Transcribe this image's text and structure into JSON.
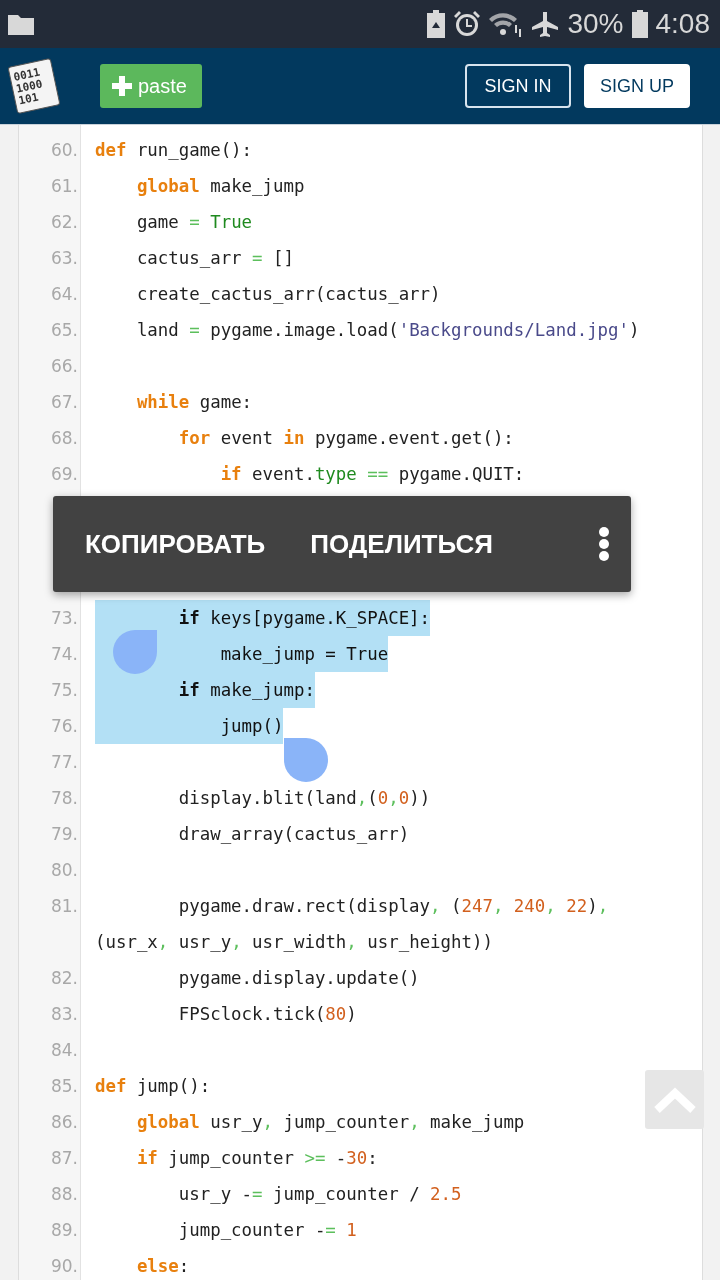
{
  "status_bar": {
    "battery_percent": "30%",
    "time": "4:08"
  },
  "header": {
    "logo_lines": [
      "0011",
      "1000",
      "101"
    ],
    "paste_button": "paste",
    "sign_in": "SIGN IN",
    "sign_up": "SIGN UP"
  },
  "code_lines": [
    {
      "kind": "line",
      "number": "60.",
      "selected": false,
      "tokens": [
        {
          "kind": "kw",
          "text": "def"
        },
        {
          "kind": "plain",
          "text": " run_game():"
        }
      ]
    },
    {
      "kind": "line",
      "number": "61.",
      "selected": false,
      "tokens": [
        {
          "kind": "kw",
          "text": "    global"
        },
        {
          "kind": "plain",
          "text": " make_jump"
        }
      ]
    },
    {
      "kind": "line",
      "number": "62.",
      "selected": false,
      "tokens": [
        {
          "kind": "plain",
          "text": "    game "
        },
        {
          "kind": "op",
          "text": "="
        },
        {
          "kind": "const",
          "text": " True"
        }
      ]
    },
    {
      "kind": "line",
      "number": "63.",
      "selected": false,
      "tokens": [
        {
          "kind": "plain",
          "text": "    cactus_arr "
        },
        {
          "kind": "op",
          "text": "="
        },
        {
          "kind": "plain",
          "text": " []"
        }
      ]
    },
    {
      "kind": "line",
      "number": "64.",
      "selected": false,
      "tokens": [
        {
          "kind": "plain",
          "text": "    create_cactus_arr(cactus_arr)"
        }
      ]
    },
    {
      "kind": "line",
      "number": "65.",
      "selected": false,
      "tokens": [
        {
          "kind": "plain",
          "text": "    land "
        },
        {
          "kind": "op",
          "text": "="
        },
        {
          "kind": "plain",
          "text": " pygame.image.load("
        },
        {
          "kind": "str",
          "text": "'Backgrounds/Land.jpg'"
        },
        {
          "kind": "plain",
          "text": ")"
        }
      ]
    },
    {
      "kind": "line",
      "number": "66.",
      "selected": false
    },
    {
      "kind": "line",
      "number": "67.",
      "selected": false,
      "tokens": [
        {
          "kind": "kw",
          "text": "    while"
        },
        {
          "kind": "plain",
          "text": " game:"
        }
      ]
    },
    {
      "kind": "line",
      "number": "68.",
      "selected": false,
      "tokens": [
        {
          "kind": "kw",
          "text": "        for"
        },
        {
          "kind": "plain",
          "text": " event "
        },
        {
          "kind": "kw",
          "text": "in"
        },
        {
          "kind": "plain",
          "text": " pygame.event.get():"
        }
      ]
    },
    {
      "kind": "line",
      "number": "69.",
      "selected": false,
      "tokens": [
        {
          "kind": "kw",
          "text": "            if"
        },
        {
          "kind": "plain",
          "text": " event."
        },
        {
          "kind": "attr",
          "text": "type"
        },
        {
          "kind": "op",
          "text": " =="
        },
        {
          "kind": "plain",
          "text": " pygame.QUIT:"
        }
      ]
    },
    {
      "kind": "menu",
      "actions": [
        "КОПИРОВАТЬ",
        "ПОДЕЛИТЬСЯ"
      ]
    },
    {
      "kind": "line",
      "number": "73.",
      "selected": true,
      "tokens": [
        {
          "kind": "kw",
          "text": "        if"
        },
        {
          "kind": "plain",
          "text": " keys[pygame.K_SPACE]:"
        }
      ]
    },
    {
      "kind": "line",
      "number": "74.",
      "selected": true,
      "start_handle": true,
      "tokens": [
        {
          "kind": "plain",
          "text": "            make_jump "
        },
        {
          "kind": "op",
          "text": "="
        },
        {
          "kind": "const",
          "text": " True"
        }
      ]
    },
    {
      "kind": "line",
      "number": "75.",
      "selected": true,
      "tokens": [
        {
          "kind": "kw",
          "text": "        if"
        },
        {
          "kind": "plain",
          "text": " make_jump:"
        }
      ]
    },
    {
      "kind": "line",
      "number": "76.",
      "selected": true,
      "tokens": [
        {
          "kind": "plain",
          "text": "            jump()"
        }
      ]
    },
    {
      "kind": "line",
      "number": "77.",
      "selected": false,
      "end_handle": true
    },
    {
      "kind": "line",
      "number": "78.",
      "selected": false,
      "tokens": [
        {
          "kind": "plain",
          "text": "        display.blit(land"
        },
        {
          "kind": "punct",
          "text": ","
        },
        {
          "kind": "plain",
          "text": "("
        },
        {
          "kind": "num",
          "text": "0"
        },
        {
          "kind": "punct",
          "text": ","
        },
        {
          "kind": "num",
          "text": "0"
        },
        {
          "kind": "plain",
          "text": "))"
        }
      ]
    },
    {
      "kind": "line",
      "number": "79.",
      "selected": false,
      "tokens": [
        {
          "kind": "plain",
          "text": "        draw_array(cactus_arr)"
        }
      ]
    },
    {
      "kind": "line",
      "number": "80.",
      "selected": false
    },
    {
      "kind": "line",
      "number": "81.",
      "selected": false,
      "tokens": [
        {
          "kind": "plain",
          "text": "        pygame.draw.rect(display"
        },
        {
          "kind": "punct",
          "text": ","
        },
        {
          "kind": "plain",
          "text": " ("
        },
        {
          "kind": "num",
          "text": "247"
        },
        {
          "kind": "punct",
          "text": ","
        },
        {
          "kind": "num",
          "text": " 240"
        },
        {
          "kind": "punct",
          "text": ","
        },
        {
          "kind": "num",
          "text": " 22"
        },
        {
          "kind": "plain",
          "text": ")"
        },
        {
          "kind": "punct",
          "text": ","
        },
        {
          "kind": "plain",
          "text": " (usr_x"
        },
        {
          "kind": "punct",
          "text": ","
        },
        {
          "kind": "plain",
          "text": " usr_y"
        },
        {
          "kind": "punct",
          "text": ","
        },
        {
          "kind": "plain",
          "text": " usr_width"
        },
        {
          "kind": "punct",
          "text": ","
        },
        {
          "kind": "plain",
          "text": " usr_height))"
        }
      ]
    },
    {
      "kind": "line",
      "number": "82.",
      "selected": false,
      "tokens": [
        {
          "kind": "plain",
          "text": "        pygame.display.update()"
        }
      ]
    },
    {
      "kind": "line",
      "number": "83.",
      "selected": false,
      "tokens": [
        {
          "kind": "plain",
          "text": "        FPSclock.tick("
        },
        {
          "kind": "num",
          "text": "80"
        },
        {
          "kind": "plain",
          "text": ")"
        }
      ]
    },
    {
      "kind": "line",
      "number": "84.",
      "selected": false
    },
    {
      "kind": "line",
      "number": "85.",
      "selected": false,
      "tokens": [
        {
          "kind": "kw",
          "text": "def"
        },
        {
          "kind": "plain",
          "text": " jump():"
        }
      ]
    },
    {
      "kind": "line",
      "number": "86.",
      "selected": false,
      "tokens": [
        {
          "kind": "kw",
          "text": "    global"
        },
        {
          "kind": "plain",
          "text": " usr_y"
        },
        {
          "kind": "punct",
          "text": ","
        },
        {
          "kind": "plain",
          "text": " jump_counter"
        },
        {
          "kind": "punct",
          "text": ","
        },
        {
          "kind": "plain",
          "text": " make_jump"
        }
      ]
    },
    {
      "kind": "line",
      "number": "87.",
      "selected": false,
      "tokens": [
        {
          "kind": "kw",
          "text": "    if"
        },
        {
          "kind": "plain",
          "text": " jump_counter "
        },
        {
          "kind": "op",
          "text": ">="
        },
        {
          "kind": "plain",
          "text": " -"
        },
        {
          "kind": "num",
          "text": "30"
        },
        {
          "kind": "plain",
          "text": ":"
        }
      ]
    },
    {
      "kind": "line",
      "number": "88.",
      "selected": false,
      "tokens": [
        {
          "kind": "plain",
          "text": "        usr_y -"
        },
        {
          "kind": "op",
          "text": "="
        },
        {
          "kind": "plain",
          "text": " jump_counter / "
        },
        {
          "kind": "num",
          "text": "2.5"
        }
      ]
    },
    {
      "kind": "line",
      "number": "89.",
      "selected": false,
      "tokens": [
        {
          "kind": "plain",
          "text": "        jump_counter -"
        },
        {
          "kind": "op",
          "text": "="
        },
        {
          "kind": "num",
          "text": " 1"
        }
      ]
    },
    {
      "kind": "line",
      "number": "90.",
      "selected": false,
      "tokens": [
        {
          "kind": "kw",
          "text": "    else"
        },
        {
          "kind": "plain",
          "text": ":"
        }
      ]
    }
  ]
}
